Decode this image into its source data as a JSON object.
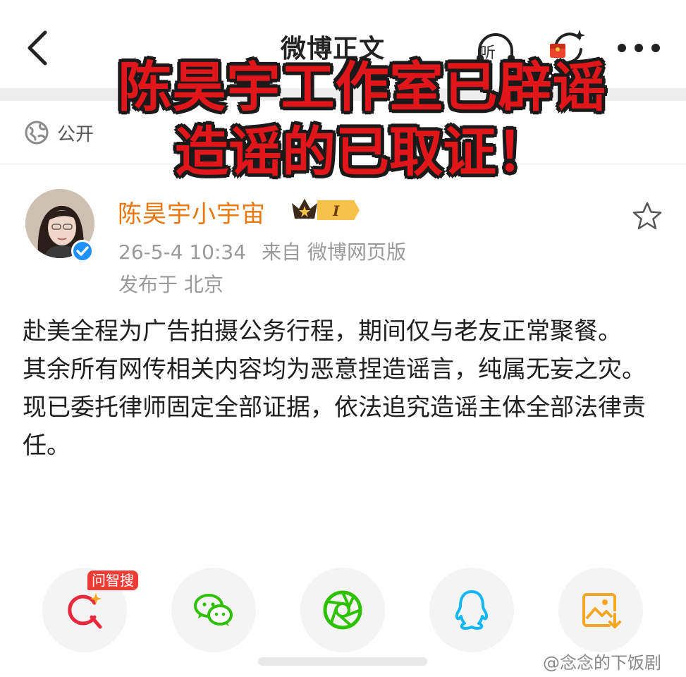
{
  "nav": {
    "title": "微博正文",
    "listen_label": "听"
  },
  "post_header": {
    "visibility": "公开"
  },
  "overlay": {
    "line1": "陈昊宇工作室已辟谣",
    "line2": "造谣的已取证！"
  },
  "author": {
    "name": "陈昊宇小宇宙",
    "badge_level": "I",
    "timestamp": "26-5-4 10:34",
    "source": "来自 微博网页版",
    "location": "发布于 北京"
  },
  "post": {
    "paragraphs": [
      "赴美全程为广告拍摄公务行程，期间仅与老友正常聚餐。",
      "其余所有网传相关内容均为恶意捏造谣言，纯属无妄之灾。",
      "现已委托律师固定全部证据，依法追究造谣主体全部法律责任。"
    ]
  },
  "share": {
    "ai_search_tag": "问智搜",
    "items": [
      "ai-search-icon",
      "wechat-icon",
      "moments-icon",
      "qq-icon",
      "save-image-icon"
    ]
  },
  "watermark": "@念念的下饭剧",
  "colors": {
    "accent_orange": "#e8780f",
    "overlay_red": "#e0161b",
    "verified_blue": "#1e90ff",
    "wechat_green": "#2dc100",
    "qq_blue": "#12b7f5",
    "save_orange": "#f5a623"
  }
}
